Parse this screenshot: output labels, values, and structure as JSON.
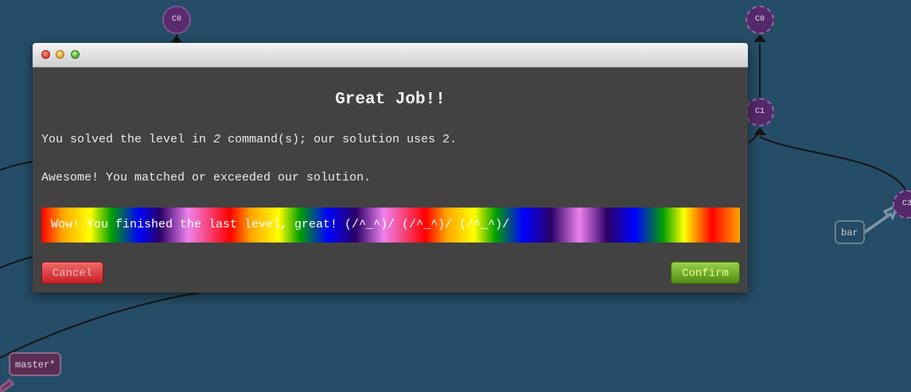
{
  "graph": {
    "nodes": {
      "c0_left": "C0",
      "c0_right": "C0",
      "c1_right": "C1",
      "c3_right": "C3"
    },
    "branches": {
      "bar": "bar",
      "master": "master*"
    },
    "colors": {
      "background": "#254d67",
      "commit": "#5a2a6e"
    }
  },
  "modal": {
    "window_controls": [
      "close",
      "minimize",
      "zoom"
    ],
    "heading": "Great Job!!",
    "message_1_prefix": "You solved the level in ",
    "message_1_count": "2",
    "message_1_suffix": " command(s); our solution uses 2.",
    "message_2": "Awesome! You matched or exceeded our solution.",
    "rainbow_text": "Wow! You finished the last level, great! (/^_^)/ (/^_^)/ (/^_^)/",
    "cancel_label": "Cancel",
    "confirm_label": "Confirm"
  }
}
